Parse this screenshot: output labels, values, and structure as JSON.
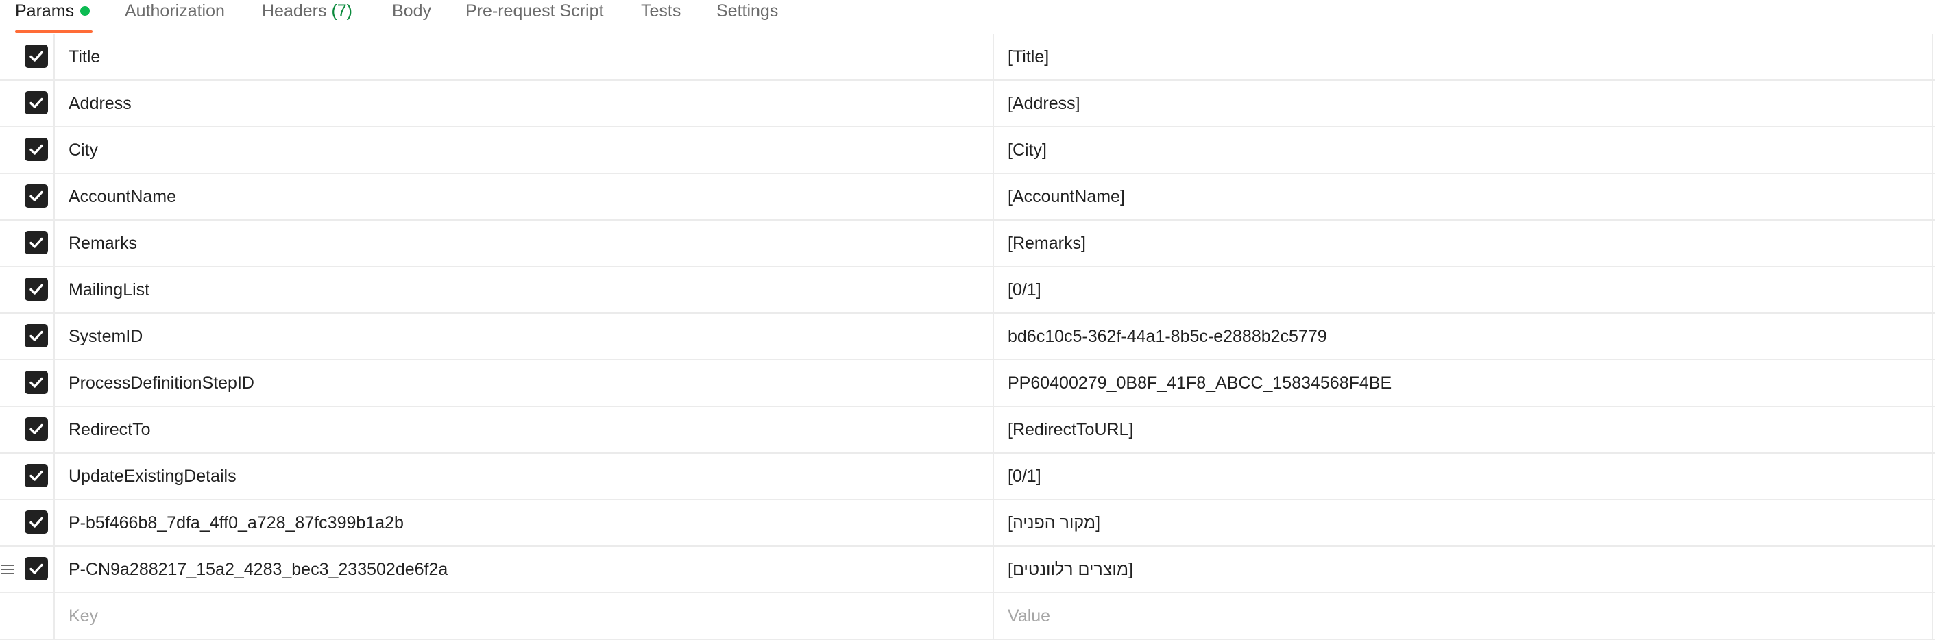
{
  "tabs": [
    {
      "label": "Params",
      "active": true,
      "status_dot_color": "#0cbb52"
    },
    {
      "label": "Authorization"
    },
    {
      "label": "Headers",
      "count": "(7)"
    },
    {
      "label": "Body"
    },
    {
      "label": "Pre-request Script"
    },
    {
      "label": "Tests"
    },
    {
      "label": "Settings"
    }
  ],
  "accent_color": "#ff6c37",
  "params": [
    {
      "checked": true,
      "key": "Title",
      "value": "[Title]"
    },
    {
      "checked": true,
      "key": "Address",
      "value": "[Address]"
    },
    {
      "checked": true,
      "key": "City",
      "value": "[City]"
    },
    {
      "checked": true,
      "key": "AccountName",
      "value": "[AccountName]"
    },
    {
      "checked": true,
      "key": "Remarks",
      "value": "[Remarks]"
    },
    {
      "checked": true,
      "key": "MailingList",
      "value": "[0/1]"
    },
    {
      "checked": true,
      "key": "SystemID",
      "value": "bd6c10c5-362f-44a1-8b5c-e2888b2c5779"
    },
    {
      "checked": true,
      "key": "ProcessDefinitionStepID",
      "value": "PP60400279_0B8F_41F8_ABCC_15834568F4BE"
    },
    {
      "checked": true,
      "key": "RedirectTo",
      "value": "[RedirectToURL]"
    },
    {
      "checked": true,
      "key": "UpdateExistingDetails",
      "value": "[0/1]"
    },
    {
      "checked": true,
      "key": "P-b5f466b8_7dfa_4ff0_a728_87fc399b1a2b",
      "value": "[מקור הפניה]"
    },
    {
      "checked": true,
      "key": "P-CN9a288217_15a2_4283_bec3_233502de6f2a",
      "value": "[מוצרים רלוונטים]"
    }
  ],
  "new_row": {
    "key_placeholder": "Key",
    "value_placeholder": "Value"
  },
  "icons": {
    "checkbox": "checkmark-icon",
    "drag": "drag-handle-icon"
  }
}
